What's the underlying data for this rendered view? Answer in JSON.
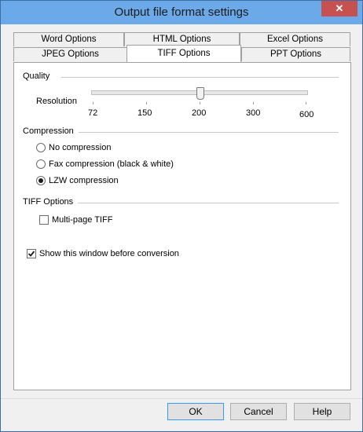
{
  "window": {
    "title": "Output file format settings",
    "close_glyph": "✕"
  },
  "tabs_top": [
    "Word Options",
    "HTML Options",
    "Excel Options"
  ],
  "tabs_bottom": [
    "JPEG Options",
    "TIFF Options",
    "PPT Options"
  ],
  "active_tab": "TIFF Options",
  "quality": {
    "group_label": "Quality",
    "resolution_label": "Resolution",
    "ticks": [
      "72",
      "150",
      "200",
      "300",
      "600"
    ],
    "selected_value": "200"
  },
  "compression": {
    "group_label": "Compression",
    "options": [
      "No compression",
      "Fax compression (black & white)",
      "LZW compression"
    ],
    "selected": "LZW compression"
  },
  "tiff_options": {
    "group_label": "TIFF Options",
    "multipage_label": "Multi-page TIFF",
    "multipage_checked": false
  },
  "show_window": {
    "label": "Show this window before conversion",
    "checked": true
  },
  "buttons": {
    "ok": "OK",
    "cancel": "Cancel",
    "help": "Help"
  },
  "colors": {
    "titlebar": "#6ba9e8",
    "close": "#c75050",
    "default_border": "#3399ff"
  }
}
